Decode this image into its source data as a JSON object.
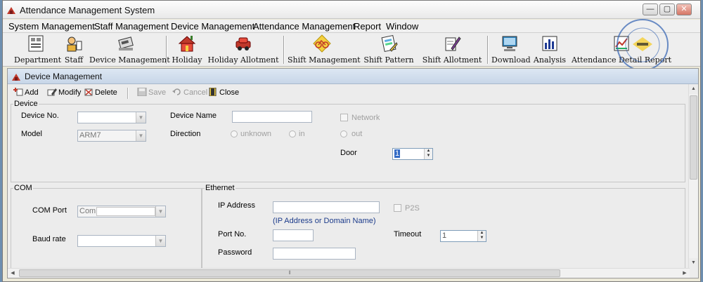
{
  "window": {
    "title": "Attendance Management System",
    "controls": {
      "minimize": "—",
      "maximize": "▢",
      "close": "✕"
    }
  },
  "menu": [
    "System Management",
    "Staff Management",
    "Device Management",
    "Attendance Management",
    "Report",
    "Window"
  ],
  "toolbar": [
    {
      "label": "Department",
      "icon": "department-icon"
    },
    {
      "label": "Staff",
      "icon": "staff-icon"
    },
    {
      "label": "Device Management",
      "icon": "device-icon"
    },
    {
      "label": "Holiday",
      "icon": "holiday-house-icon"
    },
    {
      "label": "Holiday Allotment",
      "icon": "car-icon"
    },
    {
      "label": "Shift Management",
      "icon": "bicycle-icon"
    },
    {
      "label": "Shift Pattern",
      "icon": "pattern-icon"
    },
    {
      "label": "Shift Allotment",
      "icon": "pen-icon"
    },
    {
      "label": "Download",
      "icon": "computer-icon"
    },
    {
      "label": "Analysis",
      "icon": "chart-bars-icon"
    },
    {
      "label": "Attendance Detail Report",
      "icon": "report-icon"
    }
  ],
  "child": {
    "title": "Device Management",
    "actions": {
      "add": "Add",
      "modify": "Modify",
      "delete": "Delete",
      "save": "Save",
      "cancel": "Cancel",
      "close": "Close"
    }
  },
  "device": {
    "legend": "Device",
    "device_no_label": "Device No.",
    "device_no_value": "",
    "device_name_label": "Device Name",
    "device_name_value": "",
    "network_label": "Network",
    "model_label": "Model",
    "model_value": "ARM7",
    "direction_label": "Direction",
    "direction_options": [
      "unknown",
      "in",
      "out"
    ],
    "door_label": "Door",
    "door_value": "1"
  },
  "com": {
    "legend": "COM",
    "port_label": "COM Port",
    "port_prefix": "Com",
    "port_value": "",
    "baud_label": "Baud rate",
    "baud_value": ""
  },
  "ethernet": {
    "legend": "Ethernet",
    "ip_label": "IP Address",
    "ip_value": "",
    "ip_hint": "(IP Address or Domain Name)",
    "p2s_label": "P2S",
    "port_label": "Port No.",
    "port_value": "",
    "password_label": "Password",
    "password_value": "",
    "timeout_label": "Timeout",
    "timeout_value": "1"
  },
  "stamp": {
    "text": "EIUS ELECTRIC CO., LTD",
    "color": "#2f5fb0"
  },
  "colors": {
    "selection": "#316ac5",
    "disabled_text": "#a0a0a0",
    "hint_text": "#1a3a8a"
  }
}
